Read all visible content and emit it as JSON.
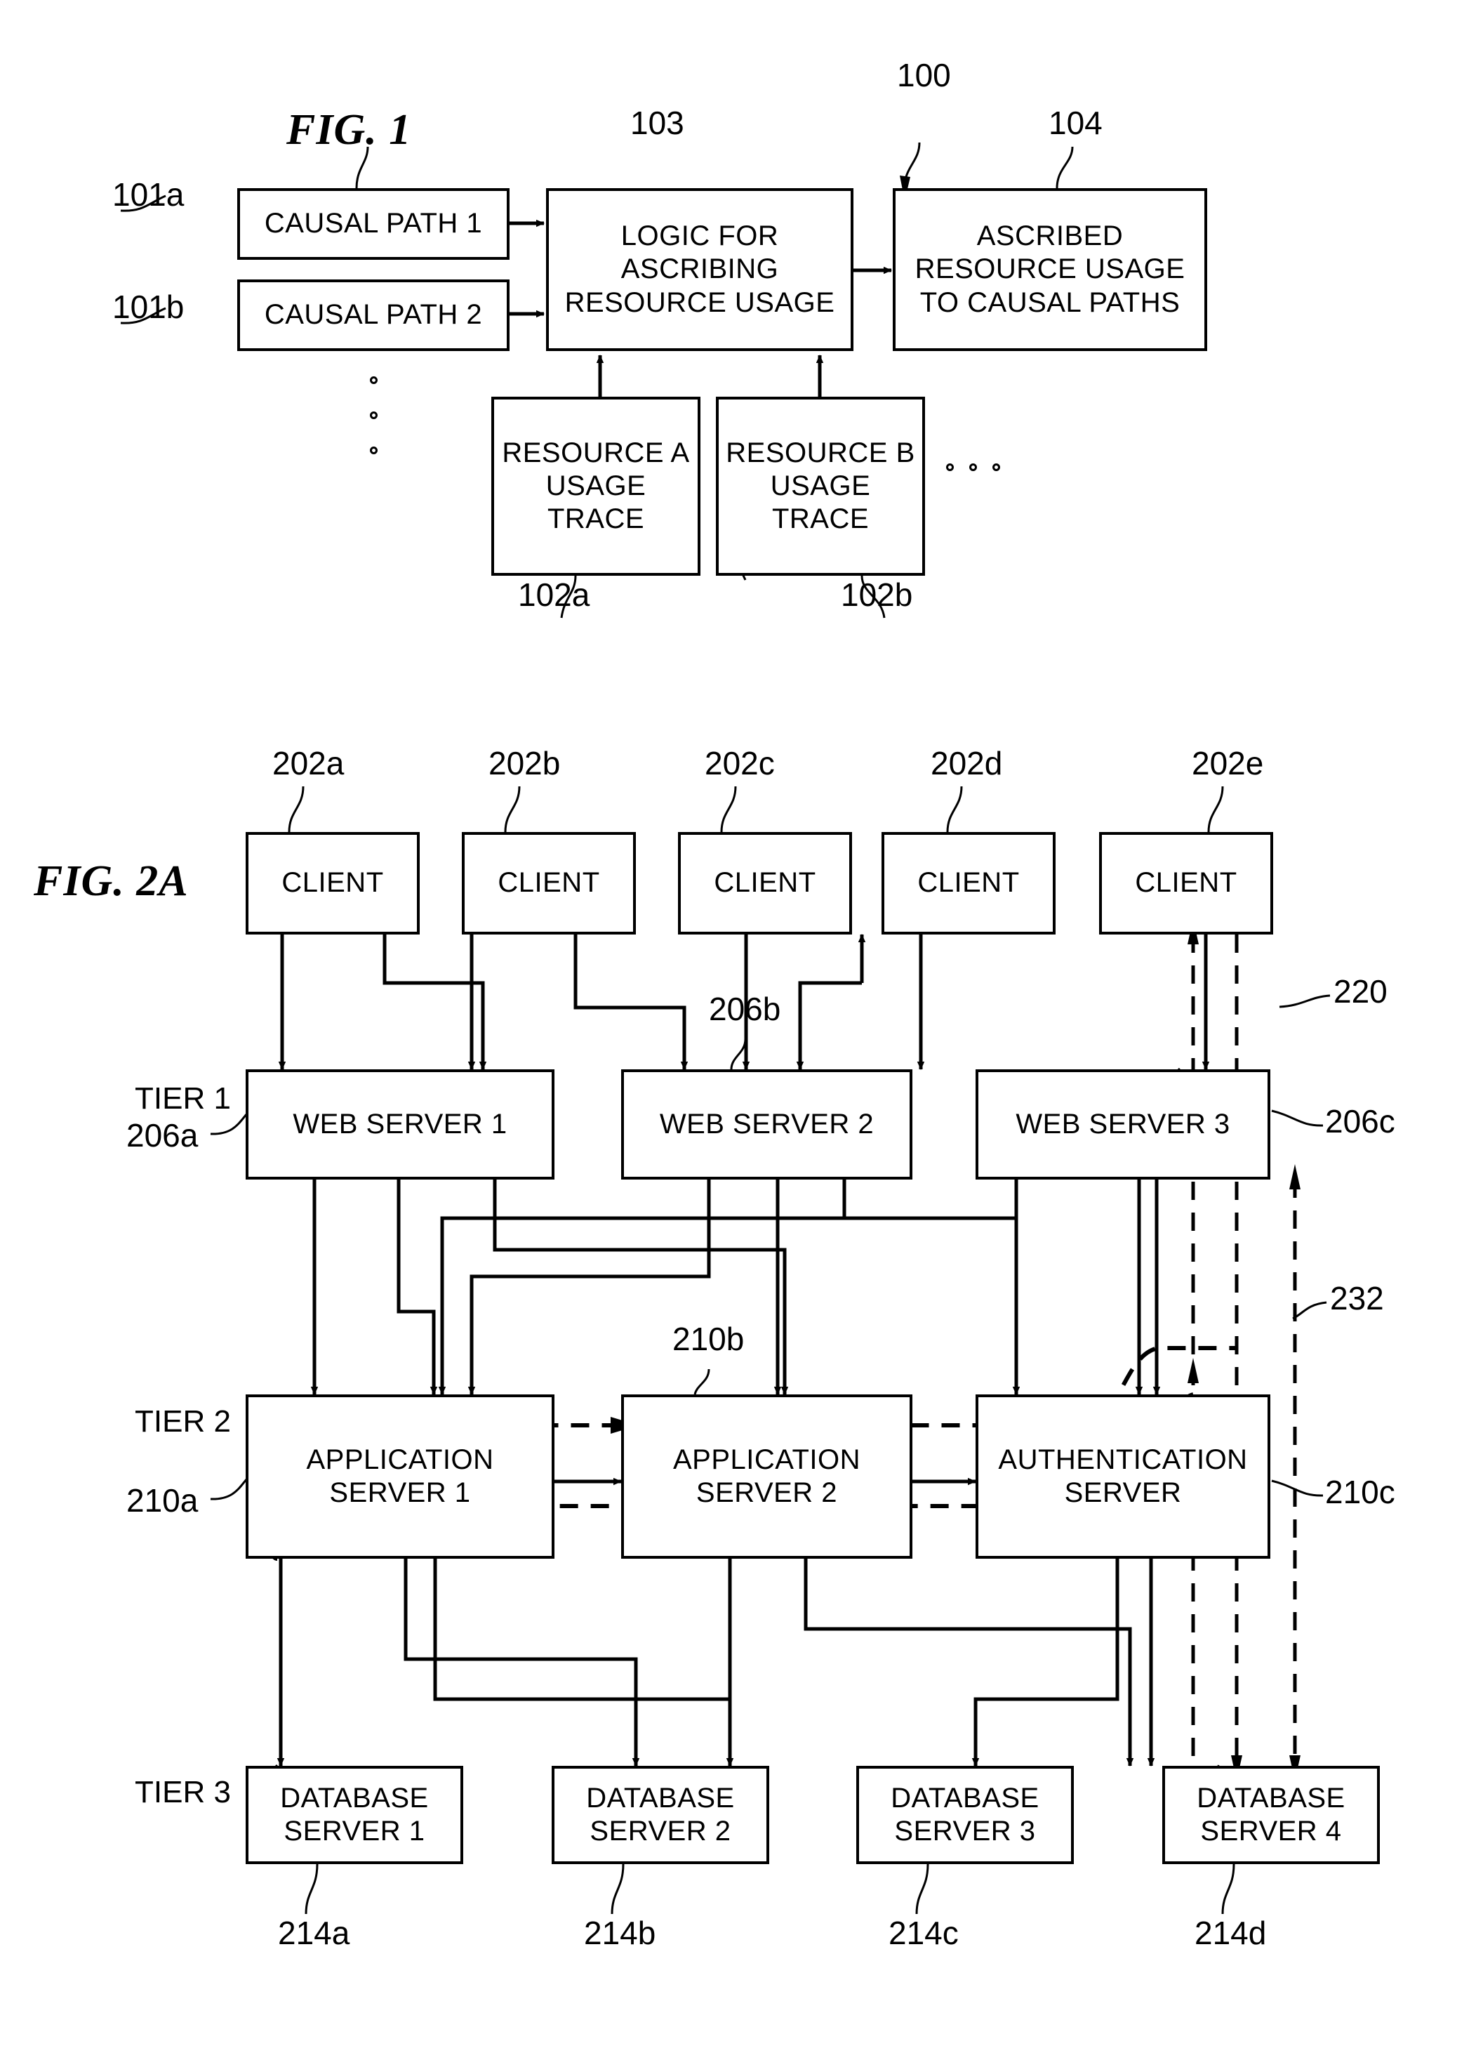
{
  "figures": [
    {
      "id": "fig1",
      "title": "FIG. 1",
      "system_ref": "100",
      "nodes": {
        "causal_path_1": {
          "ref": "101a",
          "lines": [
            "CAUSAL PATH 1"
          ]
        },
        "causal_path_2": {
          "ref": "101b",
          "lines": [
            "CAUSAL PATH 2"
          ]
        },
        "logic": {
          "ref": "103",
          "lines": [
            "LOGIC FOR",
            "ASCRIBING",
            "RESOURCE USAGE"
          ]
        },
        "ascribed": {
          "ref": "104",
          "lines": [
            "ASCRIBED",
            "RESOURCE USAGE",
            "TO CAUSAL PATHS"
          ]
        },
        "resource_a": {
          "ref": "102a",
          "lines": [
            "RESOURCE A",
            "USAGE",
            "TRACE"
          ]
        },
        "resource_b": {
          "ref": "102b",
          "lines": [
            "RESOURCE B",
            "USAGE",
            "TRACE"
          ]
        }
      }
    },
    {
      "id": "fig2a",
      "title": "FIG. 2A",
      "tier_labels": [
        "TIER 1",
        "TIER 2",
        "TIER 3"
      ],
      "path_refs": {
        "path_220": "220",
        "path_232": "232"
      },
      "clients": [
        {
          "ref": "202a",
          "label": "CLIENT"
        },
        {
          "ref": "202b",
          "label": "CLIENT"
        },
        {
          "ref": "202c",
          "label": "CLIENT"
        },
        {
          "ref": "202d",
          "label": "CLIENT"
        },
        {
          "ref": "202e",
          "label": "CLIENT"
        }
      ],
      "tier1": [
        {
          "ref": "206a",
          "lines": [
            "WEB SERVER 1"
          ]
        },
        {
          "ref": "206b",
          "lines": [
            "WEB SERVER 2"
          ]
        },
        {
          "ref": "206c",
          "lines": [
            "WEB SERVER 3"
          ]
        }
      ],
      "tier2": [
        {
          "ref": "210a",
          "lines": [
            "APPLICATION",
            "SERVER 1"
          ]
        },
        {
          "ref": "210b",
          "lines": [
            "APPLICATION",
            "SERVER 2"
          ]
        },
        {
          "ref": "210c",
          "lines": [
            "AUTHENTICATION",
            "SERVER"
          ]
        }
      ],
      "tier3": [
        {
          "ref": "214a",
          "lines": [
            "DATABASE",
            "SERVER 1"
          ]
        },
        {
          "ref": "214b",
          "lines": [
            "DATABASE",
            "SERVER 2"
          ]
        },
        {
          "ref": "214c",
          "lines": [
            "DATABASE",
            "SERVER 3"
          ]
        },
        {
          "ref": "214d",
          "lines": [
            "DATABASE",
            "SERVER 4"
          ]
        }
      ]
    }
  ],
  "colors": {
    "ink": "#000000",
    "paper": "#ffffff"
  }
}
